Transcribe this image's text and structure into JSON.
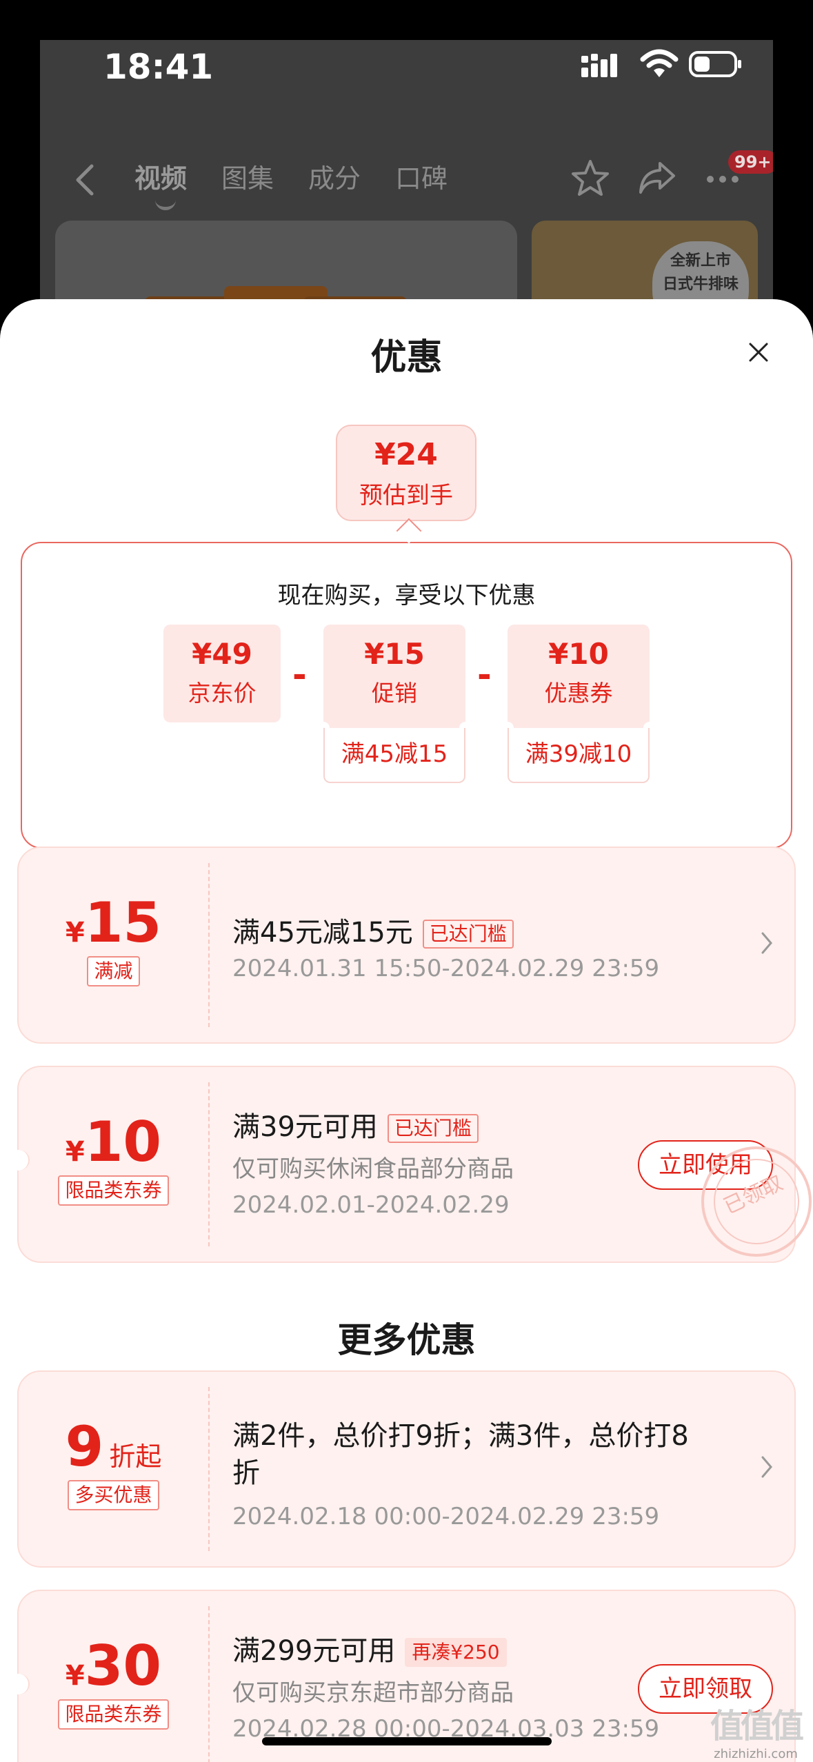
{
  "status_bar": {
    "time": "18:41"
  },
  "product_page": {
    "tabs": [
      "视频",
      "图集",
      "成分",
      "口碑"
    ],
    "active_tab": "视频",
    "more_badge": "99+",
    "thumb_tag": [
      "全新上市",
      "日式牛排味"
    ]
  },
  "sheet": {
    "title": "优惠",
    "estimate": {
      "price": "¥24",
      "label": "预估到手"
    },
    "breakdown": {
      "heading": "现在购买，享受以下优惠",
      "items": [
        {
          "value": "¥49",
          "label": "京东价"
        },
        {
          "value": "¥15",
          "label": "促销",
          "condition": "满45减15"
        },
        {
          "value": "¥10",
          "label": "优惠券",
          "condition": "满39减10"
        }
      ],
      "operator": "-"
    },
    "offers": [
      {
        "currency": "¥",
        "amount": "15",
        "tag": "满减",
        "title": "满45元减15元",
        "pill": "已达门槛",
        "time": "2024.01.31 15:50-2024.02.29 23:59"
      },
      {
        "currency": "¥",
        "amount": "10",
        "tag": "限品类东券",
        "title": "满39元可用",
        "pill": "已达门槛",
        "scope": "仅可购买休闲食品部分商品",
        "time": "2024.02.01-2024.02.29",
        "button": "立即使用",
        "stamp": "已领取"
      }
    ],
    "more_title": "更多优惠",
    "more_offers": [
      {
        "amount": "9",
        "suffix": "折起",
        "tag": "多买优惠",
        "title": "满2件，总价打9折；满3件，总价打8",
        "title_line2": "折",
        "time": "2024.02.18 00:00-2024.02.29 23:59"
      },
      {
        "currency": "¥",
        "amount": "30",
        "tag": "限品类东券",
        "title": "满299元可用",
        "pill": "再凑¥250",
        "scope": "仅可购买京东超市部分商品",
        "time": "2024.02.28 00:00-2024.03.03 23:59",
        "button": "立即领取"
      }
    ]
  },
  "watermark": {
    "main": "值值值",
    "sub": "zhizhizhi.com"
  },
  "colors": {
    "accent": "#e2231a",
    "card_bg": "#fff1ef",
    "dim_overlay": "#3d3d3d"
  }
}
